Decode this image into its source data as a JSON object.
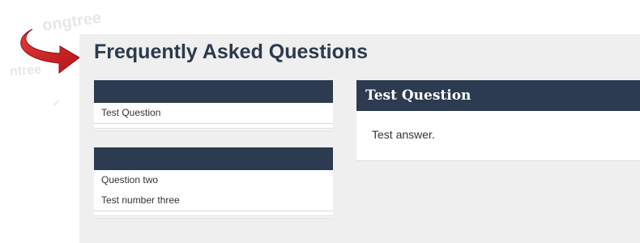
{
  "background": {
    "brand_text_top": "ongtree",
    "brand_text_mid": "ntree",
    "check_glyph": "✓"
  },
  "colors": {
    "accent_arrow": "#d8232a",
    "header_bar": "#2c3b4f",
    "panel_bg": "#efefef",
    "title_text": "#2b3a4c"
  },
  "icons": {
    "pointer": "red-curved-arrow-icon"
  },
  "page": {
    "title": "Frequently Asked Questions"
  },
  "categories": [
    {
      "items": [
        "Test Question"
      ]
    },
    {
      "items": [
        "Question two",
        "Test number three"
      ]
    }
  ],
  "answer": {
    "title": "Test Question",
    "body": "Test answer."
  }
}
